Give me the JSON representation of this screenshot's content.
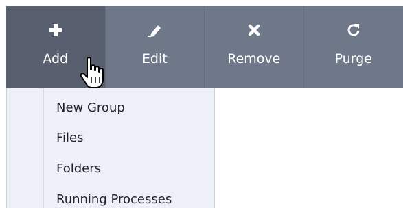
{
  "toolbar": {
    "background": "#6f7888",
    "active_background": "#58606f",
    "buttons": [
      {
        "label": "Add",
        "icon": "plus-icon"
      },
      {
        "label": "Edit",
        "icon": "pencil-icon"
      },
      {
        "label": "Remove",
        "icon": "x-icon"
      },
      {
        "label": "Purge",
        "icon": "refresh-icon"
      }
    ]
  },
  "dropdown": {
    "items": [
      {
        "label": "New Group"
      },
      {
        "label": "Files"
      },
      {
        "label": "Folders"
      },
      {
        "label": "Running Processes"
      }
    ]
  },
  "cursor": {
    "icon": "hand-pointer-icon"
  }
}
